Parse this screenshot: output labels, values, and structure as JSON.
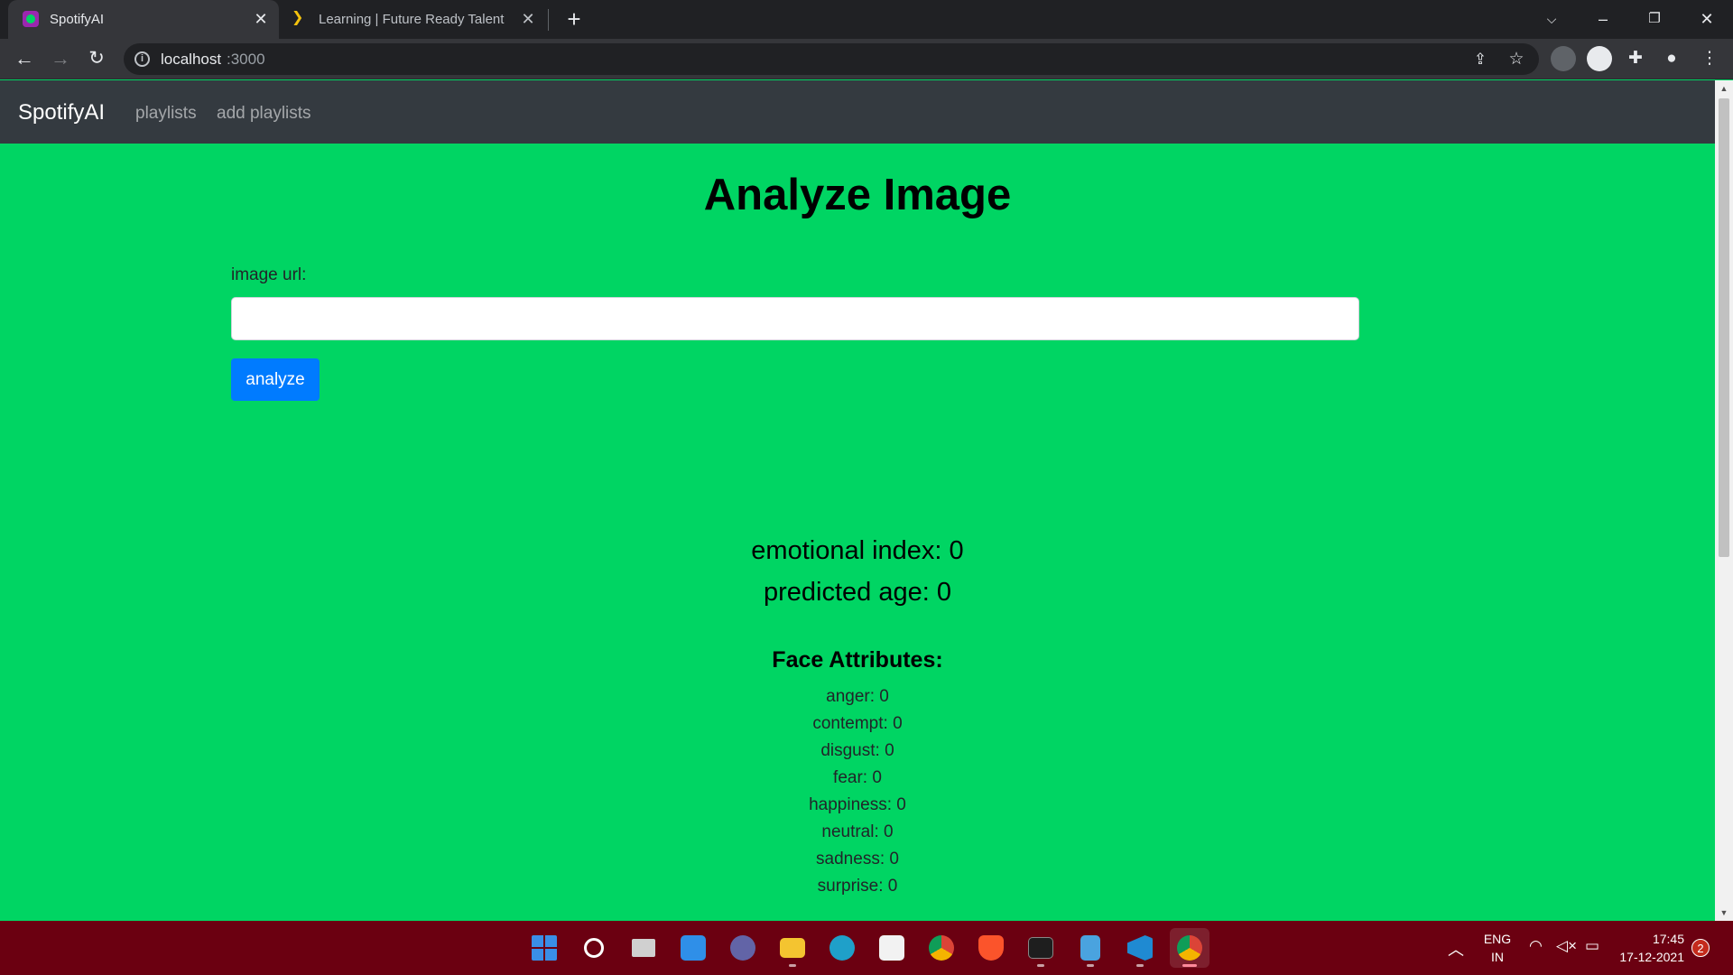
{
  "browser": {
    "tabs": [
      {
        "title": "SpotifyAI",
        "active": true
      },
      {
        "title": "Learning | Future Ready Talent",
        "active": false
      }
    ],
    "url_host": "localhost",
    "url_port": ":3000"
  },
  "navbar": {
    "brand": "SpotifyAI",
    "links": [
      "playlists",
      "add playlists"
    ]
  },
  "main": {
    "title": "Analyze Image",
    "url_label": "image url:",
    "url_value": "",
    "analyze_label": "analyze",
    "emotional_index_label": "emotional index:",
    "emotional_index_value": "0",
    "predicted_age_label": "predicted age:",
    "predicted_age_value": "0",
    "face_attributes_title": "Face Attributes:",
    "attributes": [
      {
        "label": "anger:",
        "value": "0"
      },
      {
        "label": "contempt:",
        "value": "0"
      },
      {
        "label": "disgust:",
        "value": "0"
      },
      {
        "label": "fear:",
        "value": "0"
      },
      {
        "label": "happiness:",
        "value": "0"
      },
      {
        "label": "neutral:",
        "value": "0"
      },
      {
        "label": "sadness:",
        "value": "0"
      },
      {
        "label": "surprise:",
        "value": "0"
      }
    ]
  },
  "taskbar": {
    "lang_1": "ENG",
    "lang_2": "IN",
    "time": "17:45",
    "date": "17-12-2021",
    "notifications": "2"
  },
  "colors": {
    "page_background": "#00d563",
    "navbar": "#343a40",
    "primary_button": "#007bff",
    "taskbar": "#6b0011"
  }
}
